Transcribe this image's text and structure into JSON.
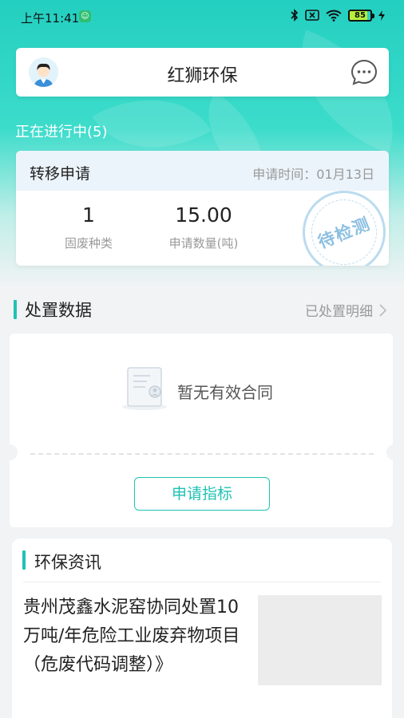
{
  "status_bar": {
    "time": "上午11:41",
    "battery": "85"
  },
  "header": {
    "app_title": "红狮环保",
    "avatar_icon": "user-avatar-icon",
    "message_icon": "chat-bubble-icon"
  },
  "in_progress": {
    "label": "正在进行中(5)"
  },
  "transfer_card": {
    "title": "转移申请",
    "apply_time": "申请时间：01月13日",
    "stats": [
      {
        "value": "1",
        "label": "固废种类"
      },
      {
        "value": "15.00",
        "label": "申请数量(吨)"
      }
    ],
    "stamp_text": "待检测"
  },
  "disposal": {
    "title": "处置数据",
    "detail_link": "已处置明细",
    "empty_text": "暂无有效合同",
    "apply_button": "申请指标"
  },
  "news": {
    "title": "环保资讯",
    "items": [
      {
        "title": "贵州茂鑫水泥窑协同处置10万吨/年危险工业废弃物项目（危废代码调整）》"
      }
    ]
  },
  "colors": {
    "accent": "#1ec2b4",
    "hero_gradient_top": "#23cfc0"
  }
}
